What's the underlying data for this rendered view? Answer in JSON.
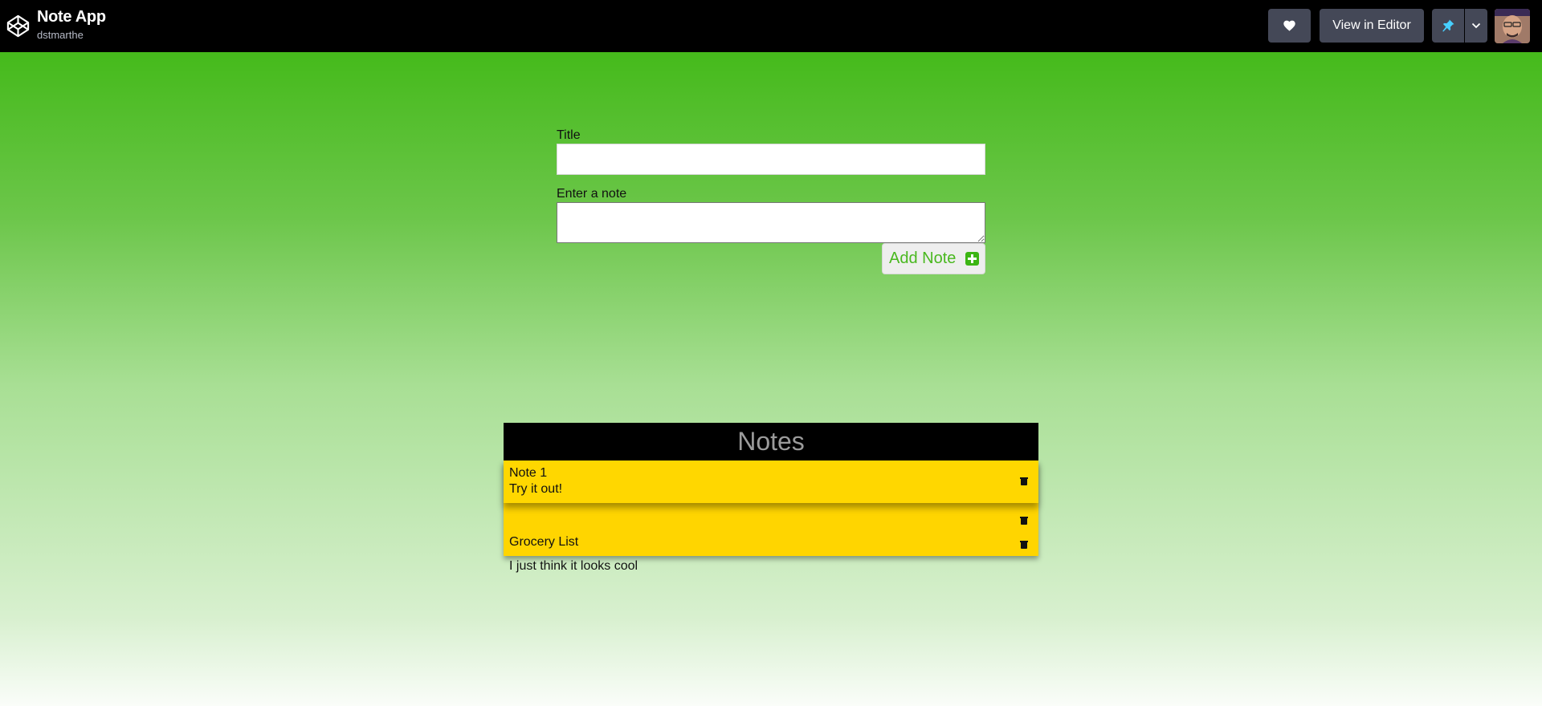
{
  "header": {
    "app_title": "Note App",
    "username": "dstmarthe",
    "view_in_editor_label": "View in Editor"
  },
  "form": {
    "title_label": "Title",
    "title_value": "",
    "note_label": "Enter a note",
    "note_value": "",
    "add_button_label": "Add Note"
  },
  "notes": {
    "heading": "Notes",
    "items": [
      {
        "title": "Note 1",
        "body": "Try it out!"
      },
      {
        "title": "Grocery List"
      },
      {
        "title": "I just think it looks cool"
      }
    ]
  },
  "colors": {
    "accent_green": "#3cb514",
    "note_yellow": "#ffd700",
    "topbar": "#000000"
  },
  "icons": [
    "codepen-logo-icon",
    "heart-icon",
    "pin-icon",
    "chevron-down-icon",
    "plus-square-icon",
    "trash-icon"
  ]
}
